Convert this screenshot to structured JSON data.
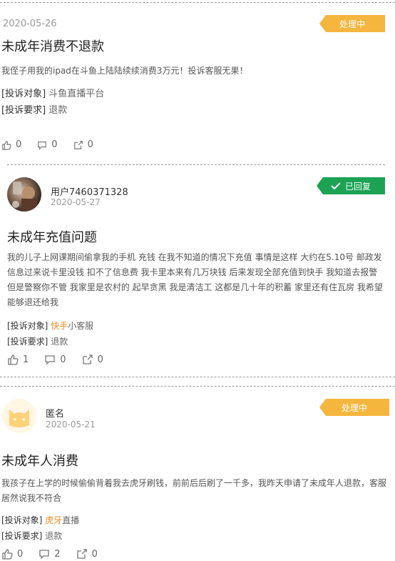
{
  "cards": [
    {
      "date": "2020-05-26",
      "status": "处理中",
      "title": "未成年消费不退款",
      "body": "我侄子用我的ipad在斗鱼上陆陆续续消费3万元！投诉客服无果！",
      "target_label": "[投诉对象]",
      "target_value": "斗鱼直播平台",
      "request_label": "[投诉要求]",
      "request_value": "退款",
      "likes": "0",
      "comments": "0",
      "shares": "0"
    },
    {
      "user": "用户7460371328",
      "date": "2020-05-27",
      "status": "已回复",
      "title": "未成年充值问题",
      "body": "我的儿子上网课期间偷拿我的手机 充钱 在我不知道的情况下充值 事情是这样 大约在5.10号 邮政发信息过来说卡里没钱 扣不了信息费 我卡里本来有几万块钱 后来发现全部充值到快手 我知道去报警 但是警察你不管 我家里是农村的 起早贪黑 我是清洁工 这都是几十年的积蓄 家里还有住瓦房 我希望能够退还给我",
      "target_label": "[投诉对象]",
      "target_value_hl": "快手",
      "target_value_rest": "小客服",
      "request_label": "[投诉要求]",
      "request_value": "退款",
      "likes": "1",
      "comments": "0",
      "shares": "0"
    },
    {
      "user": "匿名",
      "date": "2020-05-21",
      "status": "处理中",
      "title": "未成年人消费",
      "body": "我孩子在上学的时候偷偷背着我去虎牙刷钱，前前后后刷了一千多，我昨天申请了未成年人退款，客服居然说我不符合",
      "target_label": "[投诉对象]",
      "target_value_hl": "虎牙",
      "target_value_rest": "直播",
      "request_label": "[投诉要求]",
      "request_value": "退款",
      "likes": "0",
      "comments": "2",
      "shares": "0"
    }
  ],
  "colors": {
    "status_processing": "#f5b63e",
    "status_replied": "#1ba253",
    "highlight": "#f08a1d"
  },
  "icons": [
    "thumbs-up-icon",
    "comment-icon",
    "share-icon",
    "check-icon",
    "cat-avatar-icon"
  ]
}
